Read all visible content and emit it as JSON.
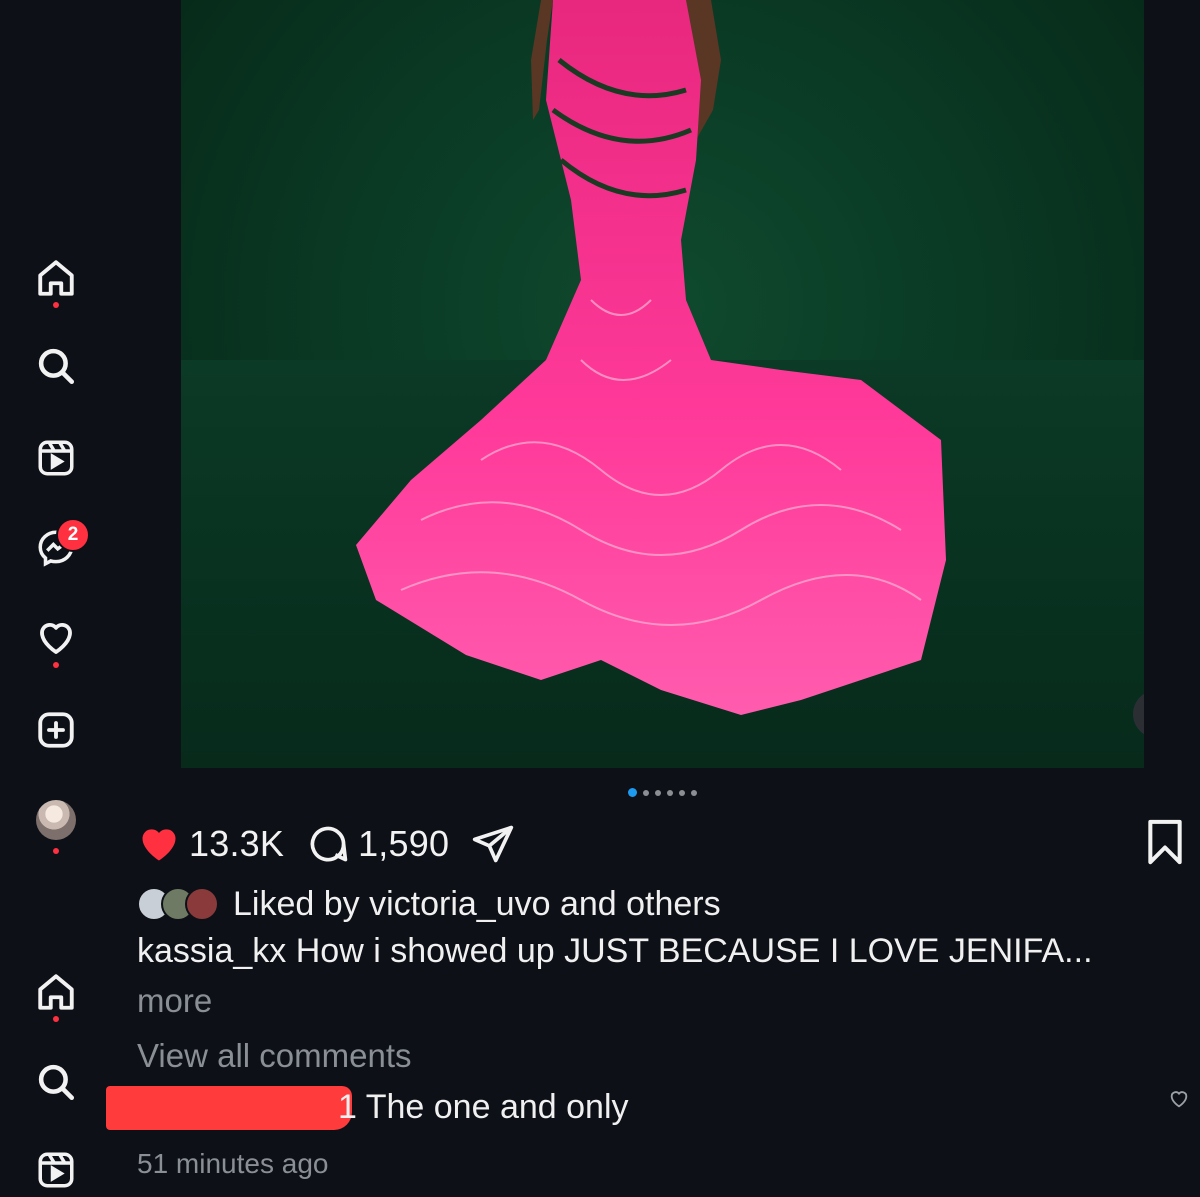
{
  "sidebar": {
    "messages_badge": "2"
  },
  "post": {
    "likes": "13.3K",
    "comments_count": "1,590",
    "carousel_count": 6,
    "carousel_active_index": 0,
    "liked_by_text": "Liked by victoria_uvo and others",
    "caption_username": "kassia_kx",
    "caption_text": "How i showed up JUST BECAUSE I LOVE JENIFA...",
    "more_label": "more",
    "view_all_comments_label": "View all comments",
    "comment_text_visible": "1 The one and only",
    "timestamp": "51 minutes ago"
  },
  "colors": {
    "like_red": "#ff3040",
    "dot_active": "#1d9bf0",
    "dress_pink": "#ff2e8f",
    "redaction_red": "#ff3b3b"
  },
  "icons": {
    "nav": [
      "home-icon",
      "search-icon",
      "reels-icon",
      "messenger-icon",
      "heart-icon",
      "create-icon",
      "profile-avatar",
      "home-icon",
      "search-icon",
      "reels-icon"
    ],
    "actions": [
      "heart-filled-icon",
      "comment-icon",
      "share-icon",
      "bookmark-icon",
      "sound-on-icon"
    ]
  }
}
